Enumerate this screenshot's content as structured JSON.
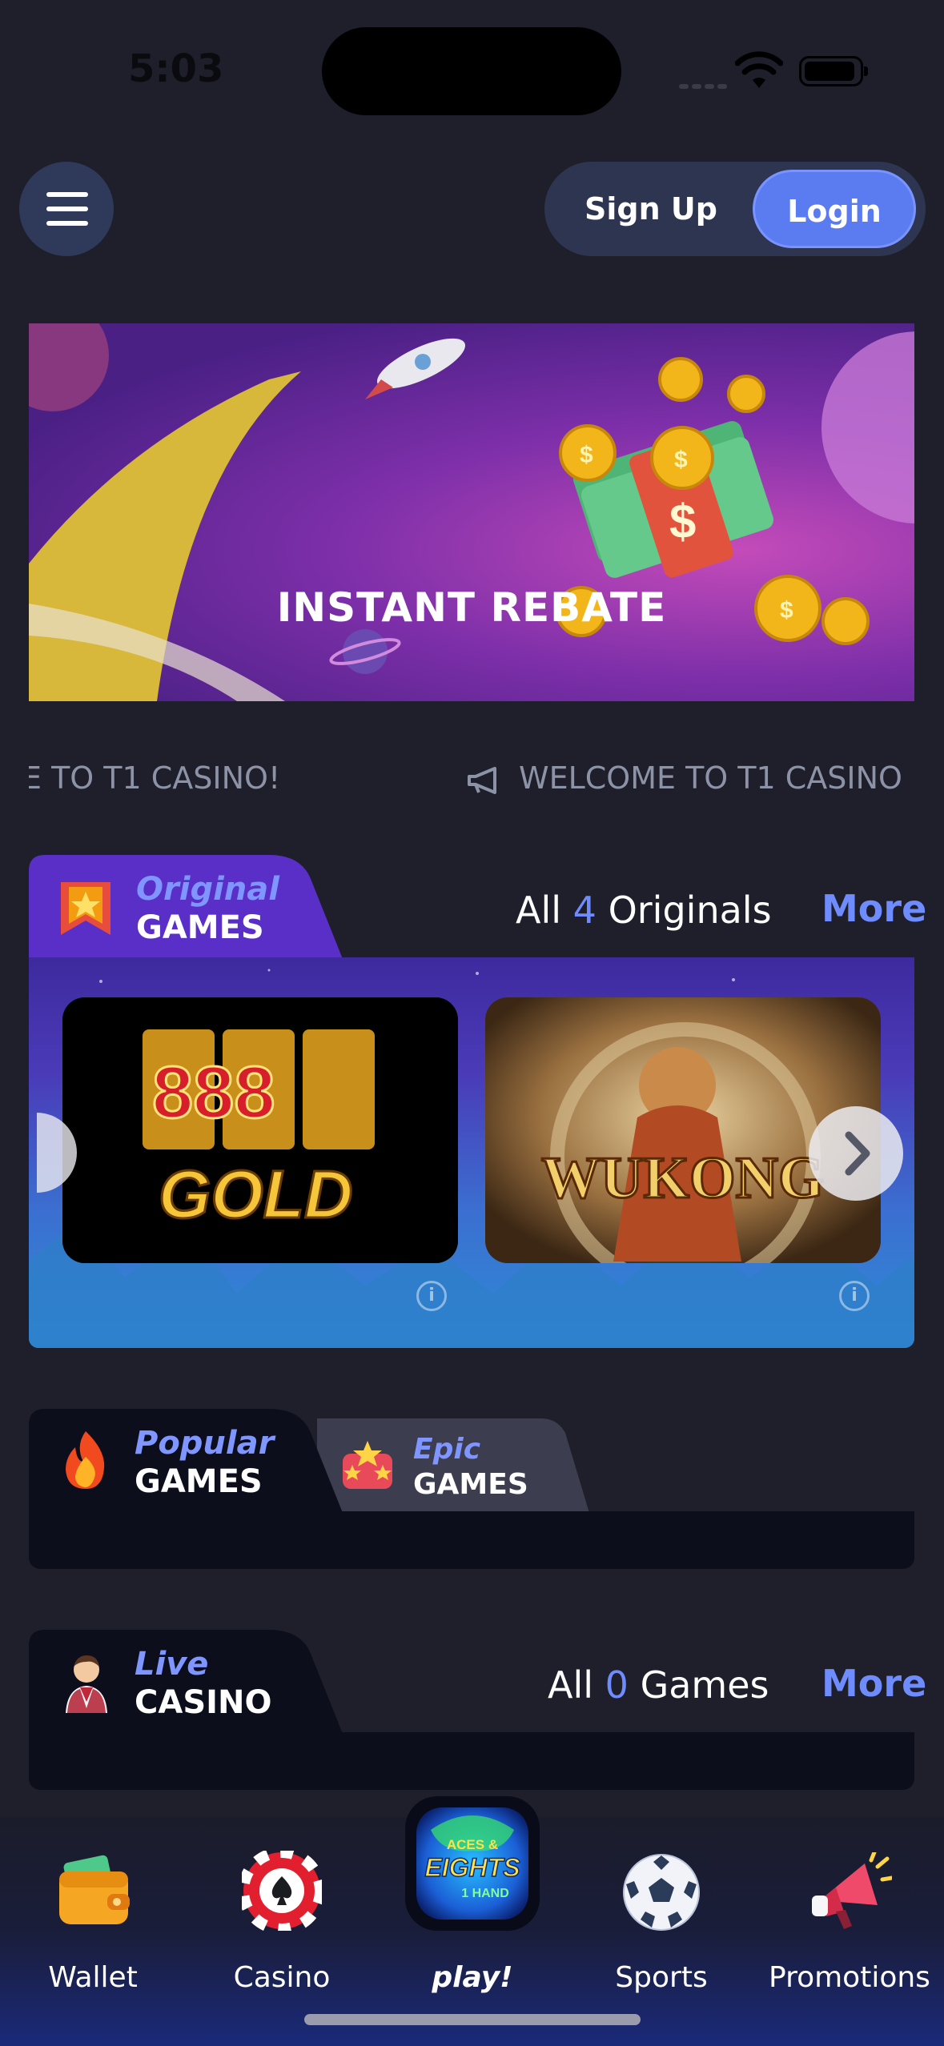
{
  "status": {
    "time": "5:03"
  },
  "header": {
    "signup_label": "Sign Up",
    "login_label": "Login"
  },
  "banner": {
    "title": "INSTANT REBATE"
  },
  "marquee": {
    "text_partial": "E TO T1 CASINO!",
    "text": "WELCOME TO T1 CASINO"
  },
  "originals": {
    "label_top": "Original",
    "label_bottom": "GAMES",
    "count_prefix": "All",
    "count": "4",
    "count_suffix": "Originals",
    "more": "More",
    "games": [
      {
        "name": "888 GOLD",
        "top": "888",
        "bottom": "GOLD"
      },
      {
        "name": "WU KONG",
        "title": "WUKONG"
      }
    ]
  },
  "popular_tabs": [
    {
      "label_top": "Popular",
      "label_bottom": "GAMES"
    },
    {
      "label_top": "Epic",
      "label_bottom": "GAMES"
    }
  ],
  "live": {
    "label_top": "Live",
    "label_bottom": "CASINO",
    "count_prefix": "All",
    "count": "0",
    "count_suffix": "Games",
    "more": "More"
  },
  "nav": [
    {
      "label": "Wallet",
      "icon": "wallet-icon"
    },
    {
      "label": "Casino",
      "icon": "poker-chip-icon"
    },
    {
      "label": "play!",
      "icon": "aces-eights-logo"
    },
    {
      "label": "Sports",
      "icon": "soccer-ball-icon"
    },
    {
      "label": "Promotions",
      "icon": "megaphone-icon"
    }
  ],
  "game_logo_text": {
    "line1": "ACES &",
    "line2": "EIGHTS",
    "line3": "1 HAND"
  },
  "colors": {
    "accent": "#5b7cf0",
    "link": "#6f8cff",
    "background": "#1e1f2b"
  }
}
